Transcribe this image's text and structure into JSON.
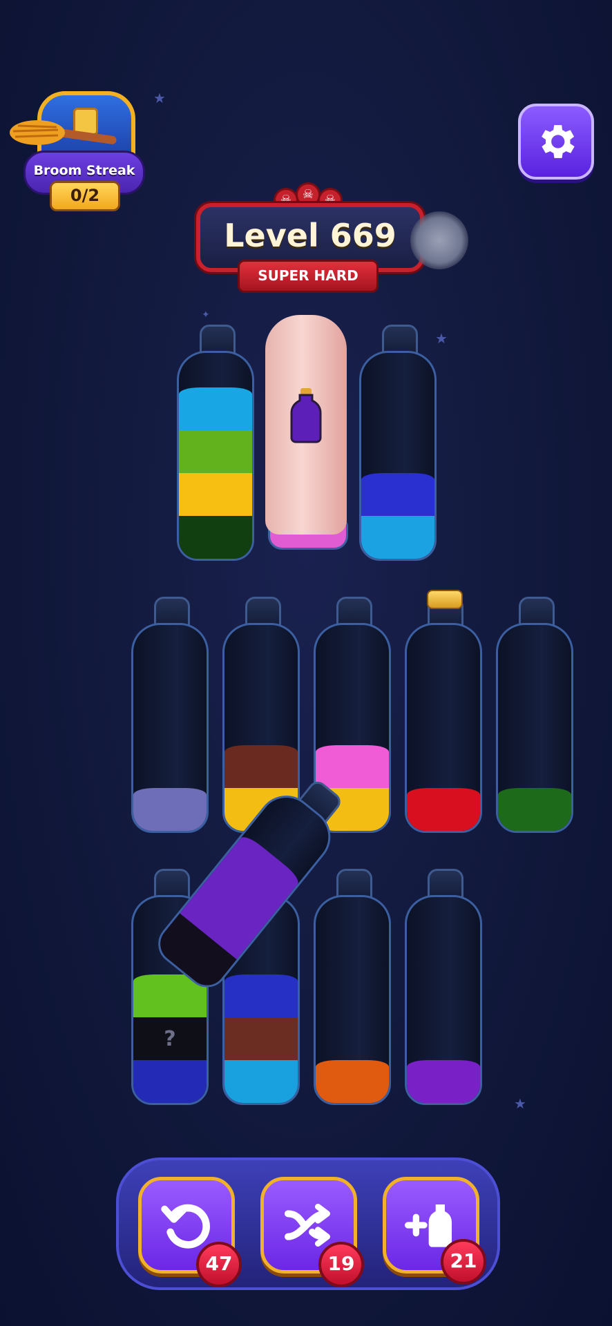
{
  "header": {
    "broom_streak": {
      "label": "Broom Streak",
      "progress": "0/2",
      "icon": "treasure-chest-icon"
    },
    "settings_icon": "gear-icon"
  },
  "level": {
    "title": "Level 669",
    "difficulty": "SUPER HARD",
    "difficulty_skulls": 3
  },
  "bottles": {
    "row1": [
      {
        "layers_top_to_bottom": [
          "#18a6e4",
          "#62b21d",
          "#f6bf12",
          "#113f10"
        ]
      },
      {
        "covered": true,
        "hint_color": "#5c1fb8"
      },
      {
        "layers_top_to_bottom": [
          "#2a2fcf",
          "#1aa2e2"
        ]
      }
    ],
    "row2": [
      {
        "layers_top_to_bottom": [
          "#6e6db8"
        ]
      },
      {
        "layers_top_to_bottom": [
          "#6a2a20",
          "#f3bd13"
        ]
      },
      {
        "layers_top_to_bottom": [
          "#f05bd6",
          "#f3bd13"
        ]
      },
      {
        "layers_top_to_bottom": [
          "#d70f1f"
        ],
        "corked": true
      },
      {
        "layers_top_to_bottom": [
          "#1d6b1a"
        ]
      }
    ],
    "row3": [
      {
        "layers_top_to_bottom": [
          "#63c11f",
          "mystery",
          "#232ab5"
        ],
        "mystery_label": "?"
      },
      {
        "layers_top_to_bottom": [
          "#2730c4",
          "#6b2c22",
          "#18a0df"
        ]
      },
      {
        "layers_top_to_bottom": [
          "#e05a0f"
        ]
      },
      {
        "layers_top_to_bottom": [
          "#7a20c7"
        ]
      }
    ],
    "pouring": {
      "layers_top_to_bottom": [
        "#6a24c2",
        "#120e1e"
      ]
    }
  },
  "boosters": [
    {
      "name": "undo",
      "icon": "undo-icon",
      "count": "47"
    },
    {
      "name": "shuffle",
      "icon": "shuffle-icon",
      "count": "19"
    },
    {
      "name": "add-bottle",
      "icon": "add-bottle-icon",
      "count": "21"
    }
  ]
}
